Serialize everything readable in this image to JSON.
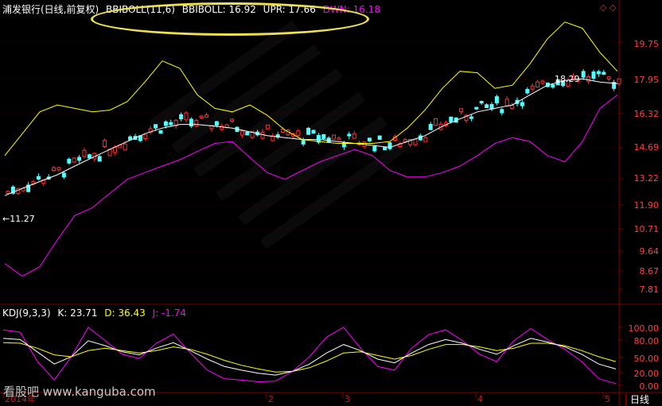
{
  "price_panel": {
    "title": "浦发银行(日线,前复权)",
    "indicator_name": "BBIBOLL(11,6)",
    "bbiboll_value": "BBIBOLL: 16.92",
    "upr_value": "UPR: 17.66",
    "dwn_value": "DWN: 16.18",
    "y_axis_labels": [
      "19.75",
      "17.95",
      "16.32",
      "14.69",
      "13.22",
      "11.90",
      "10.71",
      "9.64",
      "8.67",
      "7.81"
    ],
    "annotations": {
      "high_label": "18.29",
      "low_label": "←11.27"
    }
  },
  "kdj_panel": {
    "indicator_name": "KDJ(9,3,3)",
    "k_value": "K: 23.71",
    "d_value": "D: 36.43",
    "j_value": "J: -1.74",
    "y_axis_labels": [
      "100.00",
      "80.00",
      "50.00",
      "20.00",
      "0.00"
    ]
  },
  "x_axis": {
    "labels": [
      "2014年",
      "2",
      "3",
      "4",
      "5"
    ]
  },
  "footer": {
    "watermark": "看股吧 www.kanguba.com",
    "period_button": "日线"
  },
  "colors": {
    "background": "#000000",
    "axis": "#800000",
    "up_candle": "#ff3232",
    "down_candle": "#54ffff",
    "boll_mid": "#ffffff",
    "boll_upper": "#ffff00",
    "boll_lower": "#ff00ff",
    "k_line": "#ffffff",
    "d_line": "#ffff00",
    "j_line": "#ff00ff",
    "highlight": "#f0e050"
  },
  "chart_data": {
    "type": "candlestick",
    "price_range": [
      7.81,
      19.75
    ],
    "indicator_range": [
      0,
      100
    ],
    "series": [
      {
        "name": "BBIBOLL",
        "values": [
          11.1,
          11.4,
          11.7,
          12.0,
          12.4,
          12.8,
          13.2,
          13.6,
          14.0,
          14.3,
          14.5,
          14.5,
          14.4,
          14.3,
          14.1,
          13.9,
          13.8,
          13.7,
          13.7,
          13.6,
          13.5,
          13.4,
          13.3,
          13.6,
          13.9,
          14.4,
          14.8,
          15.2,
          15.4,
          15.6,
          16.2,
          16.8,
          17.1,
          17.2,
          17.0,
          16.9
        ]
      },
      {
        "name": "UPR",
        "values": [
          12.9,
          14.0,
          15.2,
          15.6,
          15.4,
          15.2,
          15.3,
          15.8,
          17.0,
          18.4,
          17.9,
          16.2,
          15.4,
          15.2,
          15.6,
          15.0,
          14.2,
          13.7,
          13.6,
          13.5,
          13.5,
          13.5,
          13.6,
          14.3,
          15.3,
          16.6,
          17.7,
          17.6,
          16.6,
          16.8,
          18.2,
          20.0,
          21.3,
          20.8,
          19.0,
          17.7
        ]
      },
      {
        "name": "DWN",
        "values": [
          8.6,
          8.2,
          8.5,
          9.4,
          10.3,
          10.6,
          11.2,
          11.8,
          12.1,
          12.4,
          12.7,
          13.1,
          13.5,
          13.6,
          12.8,
          12.1,
          11.8,
          12.2,
          12.6,
          12.9,
          13.2,
          12.9,
          12.2,
          11.9,
          11.9,
          12.1,
          12.4,
          12.9,
          13.5,
          13.8,
          13.6,
          12.9,
          12.6,
          13.6,
          15.4,
          16.2
        ]
      }
    ],
    "kdj": {
      "K": [
        82,
        80,
        60,
        40,
        52,
        78,
        70,
        60,
        55,
        66,
        75,
        62,
        48,
        36,
        30,
        25,
        22,
        28,
        40,
        58,
        72,
        62,
        48,
        42,
        58,
        72,
        80,
        74,
        64,
        56,
        70,
        82,
        76,
        68,
        56,
        40,
        32
      ],
      "D": [
        75,
        74,
        66,
        55,
        52,
        62,
        66,
        62,
        58,
        62,
        68,
        64,
        56,
        46,
        38,
        32,
        27,
        28,
        34,
        45,
        58,
        60,
        54,
        48,
        54,
        64,
        72,
        72,
        68,
        62,
        66,
        74,
        74,
        70,
        62,
        52,
        44
      ],
      "J": [
        96,
        92,
        45,
        14,
        52,
        100,
        78,
        56,
        49,
        74,
        89,
        58,
        30,
        16,
        14,
        11,
        12,
        28,
        52,
        84,
        100,
        66,
        36,
        30,
        66,
        88,
        96,
        78,
        56,
        44,
        78,
        98,
        80,
        64,
        44,
        16,
        8
      ]
    }
  }
}
